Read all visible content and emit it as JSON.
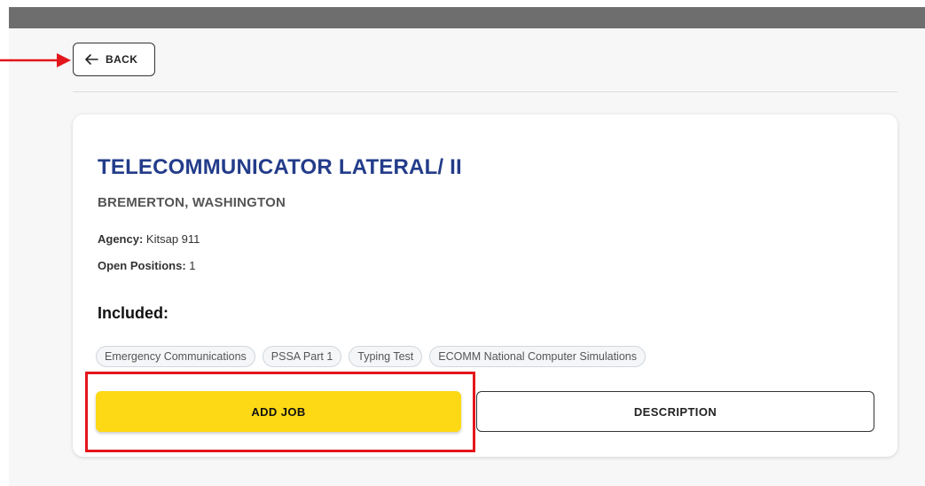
{
  "header": {
    "back_label": "BACK"
  },
  "job": {
    "title": "TELECOMMUNICATOR LATERAL/ II",
    "location": "BREMERTON, WASHINGTON",
    "agency_label": "Agency:",
    "agency_value": "Kitsap 911",
    "positions_label": "Open Positions:",
    "positions_value": "1"
  },
  "included": {
    "heading": "Included:",
    "tags": [
      "Emergency Communications",
      "PSSA Part 1",
      "Typing Test",
      "ECOMM National Computer Simulations"
    ]
  },
  "actions": {
    "add_job_label": "ADD JOB",
    "description_label": "DESCRIPTION"
  },
  "colors": {
    "title": "#233c8a",
    "add_job_bg": "#fdd815",
    "annotation": "#e3161c",
    "topbar": "#6e6e6e"
  },
  "icons": {
    "back": "arrow-left-icon",
    "annotation_arrow": "arrow-right-icon"
  }
}
